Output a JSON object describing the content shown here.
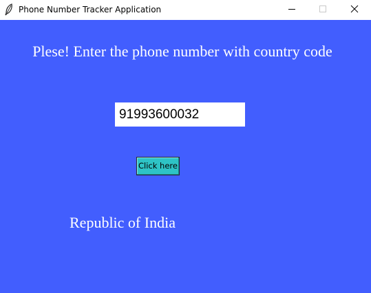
{
  "window": {
    "title": "Phone Number Tracker Application",
    "icon": "feather-icon",
    "controls": {
      "minimize_icon": "minimize-icon",
      "maximize_icon": "maximize-icon",
      "close_icon": "close-icon"
    }
  },
  "colors": {
    "background": "#425efe",
    "button": "#2ec3c6",
    "text": "#ffffff"
  },
  "main": {
    "prompt": "Plese! Enter the phone number with country code",
    "phone_input_value": "91993600032",
    "button_label": "Click here",
    "result": "Republic of India"
  }
}
